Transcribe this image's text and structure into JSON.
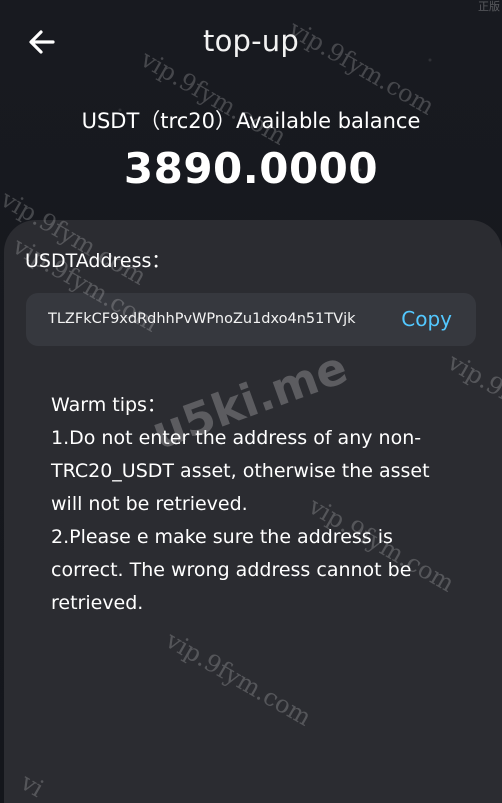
{
  "header": {
    "title": "top-up",
    "back_icon": "back-arrow-icon"
  },
  "balance": {
    "label": "USDT（trc20）Available balance",
    "value": "3890.0000"
  },
  "address": {
    "label": "USDTAddress：",
    "value": "TLZFkCF9xdRdhhPvWPnoZu1dxo4n51TVjk",
    "copy_label": "Copy"
  },
  "tips": {
    "title": "Warm tips：",
    "line1": "1.Do not enter the address of any non-TRC20_USDT asset, otherwise the asset will not be retrieved.",
    "line2": "2.Please e make sure the address is correct. The wrong address cannot be retrieved."
  },
  "watermarks": {
    "site": "vip.9fym.com",
    "big": "u5ki.me",
    "partial": "vi",
    "corner": "正版"
  },
  "colors": {
    "background": "#14161b",
    "card": "#2b2c31",
    "address_box": "#36383e",
    "copy": "#53c8ff",
    "text": "#ffffff"
  }
}
